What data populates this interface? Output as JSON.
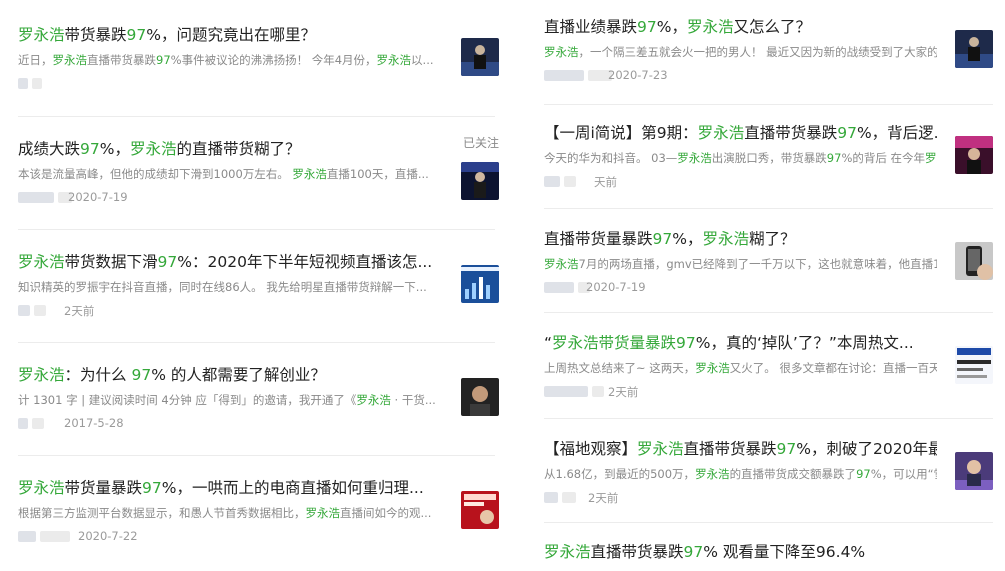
{
  "left": [
    {
      "title": [
        {
          "t": "罗永浩",
          "h": true
        },
        {
          "t": "带货暴跌"
        },
        {
          "t": "97",
          "h": true
        },
        {
          "t": "%，问题究竟出在哪里？"
        }
      ],
      "snippet": [
        {
          "t": "近日，"
        },
        {
          "t": "罗永浩",
          "h": true
        },
        {
          "t": "直播带货暴跌"
        },
        {
          "t": "97",
          "h": true
        },
        {
          "t": "%事件被议论的沸沸扬扬！ 今年4月份，"
        },
        {
          "t": "罗永浩",
          "h": true
        },
        {
          "t": "以..."
        }
      ],
      "date": "",
      "thumb": "dark-stage",
      "followed": ""
    },
    {
      "title": [
        {
          "t": "成绩大跌"
        },
        {
          "t": "97",
          "h": true
        },
        {
          "t": "%，"
        },
        {
          "t": "罗永浩",
          "h": true
        },
        {
          "t": "的直播带货糊了？"
        }
      ],
      "snippet": [
        {
          "t": "本该是流量高峰，但他的成绩却下滑到1000万左右。 "
        },
        {
          "t": "罗永浩",
          "h": true
        },
        {
          "t": "直播100天，直播..."
        }
      ],
      "date": "2020-7-19",
      "thumb": "blue-stage",
      "followed": "已关注"
    },
    {
      "title": [
        {
          "t": "罗永浩",
          "h": true
        },
        {
          "t": "带货数据下滑"
        },
        {
          "t": "97",
          "h": true
        },
        {
          "t": "%：2020年下半年短视频直播该怎..."
        }
      ],
      "snippet": [
        {
          "t": "知识精英的罗振宇在抖音直播，同时在线86人。 我先给明星直播带货辩解一下..."
        }
      ],
      "date": "2天前",
      "thumb": "blue-chart",
      "followed": ""
    },
    {
      "title": [
        {
          "t": "罗永浩",
          "h": true
        },
        {
          "t": "：为什么 "
        },
        {
          "t": "97",
          "h": true
        },
        {
          "t": "% 的人都需要了解创业？"
        }
      ],
      "snippet": [
        {
          "t": "计 1301 字 | 建议阅读时间 4分钟 应「得到」的邀请，我开通了《"
        },
        {
          "t": "罗永浩",
          "h": true
        },
        {
          "t": " · 干货..."
        }
      ],
      "date": "2017-5-28",
      "thumb": "portrait",
      "followed": ""
    },
    {
      "title": [
        {
          "t": "罗永浩",
          "h": true
        },
        {
          "t": "带货量暴跌"
        },
        {
          "t": "97",
          "h": true
        },
        {
          "t": "%，一哄而上的电商直播如何重归理..."
        }
      ],
      "snippet": [
        {
          "t": "根据第三方监测平台数据显示，和愚人节首秀数据相比，"
        },
        {
          "t": "罗永浩",
          "h": true
        },
        {
          "t": "直播间如今的观..."
        }
      ],
      "date": "2020-7-22",
      "thumb": "red-poster",
      "followed": ""
    }
  ],
  "right": [
    {
      "title": [
        {
          "t": "直播业绩暴跌"
        },
        {
          "t": "97",
          "h": true
        },
        {
          "t": "%，"
        },
        {
          "t": "罗永浩",
          "h": true
        },
        {
          "t": "又怎么了？"
        }
      ],
      "snippet": [
        {
          "t": "罗永浩",
          "h": true
        },
        {
          "t": "，一个隔三差五就会火一把的男人！ 最近又因为新的战绩受到了大家的..."
        }
      ],
      "date": "2020-7-23",
      "thumb": "dark-stage"
    },
    {
      "title": [
        {
          "t": "【一周i简说】第9期："
        },
        {
          "t": "罗永浩",
          "h": true
        },
        {
          "t": "直播带货暴跌"
        },
        {
          "t": "97",
          "h": true
        },
        {
          "t": "%，背后逻..."
        }
      ],
      "snippet": [
        {
          "t": "今天的华为和抖音。 03—"
        },
        {
          "t": "罗永浩",
          "h": true
        },
        {
          "t": "出演脱口秀，带货暴跌"
        },
        {
          "t": "97",
          "h": true
        },
        {
          "t": "%的背后 在今年"
        },
        {
          "t": "罗永...",
          "h": true
        }
      ],
      "date": "天前",
      "thumb": "pink-stage"
    },
    {
      "title": [
        {
          "t": "直播带货量暴跌"
        },
        {
          "t": "97",
          "h": true
        },
        {
          "t": "%，"
        },
        {
          "t": "罗永浩",
          "h": true
        },
        {
          "t": "糊了？"
        }
      ],
      "snippet": [
        {
          "t": "罗永浩",
          "h": true
        },
        {
          "t": "7月的两场直播，gmv已经降到了一千万以下，这也就意味着，他直播10..."
        }
      ],
      "date": "2020-7-19",
      "thumb": "phone-hand"
    },
    {
      "title": [
        {
          "t": "“"
        },
        {
          "t": "罗永浩带货量暴跌",
          "h": true
        },
        {
          "t": "97",
          "h": true
        },
        {
          "t": "%，真的‘掉队’了？”本周热文..."
        }
      ],
      "snippet": [
        {
          "t": "上周热文总结来了~ 这两天，"
        },
        {
          "t": "罗永浩",
          "h": true
        },
        {
          "t": "又火了。 很多文章都在讨论：直播一百天..."
        }
      ],
      "date": "2天前",
      "thumb": "news-card"
    },
    {
      "title": [
        {
          "t": "【福地观察】"
        },
        {
          "t": "罗永浩",
          "h": true
        },
        {
          "t": "直播带货暴跌"
        },
        {
          "t": "97",
          "h": true
        },
        {
          "t": "%，刺破了2020年最..."
        }
      ],
      "snippet": [
        {
          "t": "从1.68亿，到最近的500万，"
        },
        {
          "t": "罗永浩",
          "h": true
        },
        {
          "t": "的直播带货成交额暴跌了"
        },
        {
          "t": "97",
          "h": true
        },
        {
          "t": "%，可以用“雪..."
        }
      ],
      "date": "2天前",
      "thumb": "purple-person"
    },
    {
      "title": [
        {
          "t": "罗永浩",
          "h": true
        },
        {
          "t": "直播带货暴跌"
        },
        {
          "t": "97",
          "h": true
        },
        {
          "t": "% 观看量下降至96.4%"
        }
      ],
      "snippet": [],
      "date": "",
      "thumb": ""
    }
  ]
}
